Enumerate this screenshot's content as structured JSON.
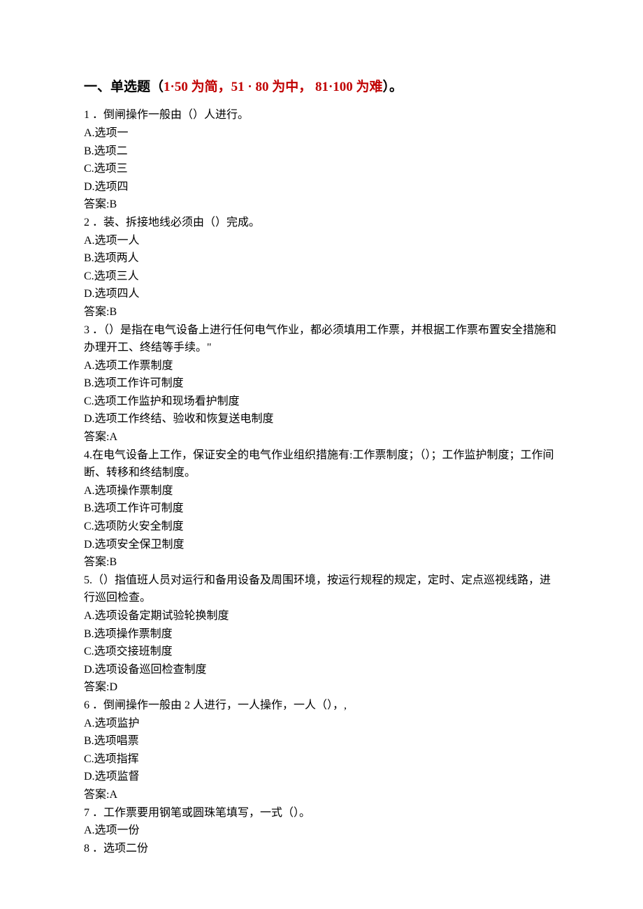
{
  "sectionTitle": {
    "prefix": "一、单选题（",
    "red": "1·50 为简，51 · 80 为中， 81·100 为难",
    "suffix": "）。"
  },
  "questions": [
    {
      "stem": "1 ．倒闸操作一般由（）人进行。",
      "options": [
        "A.选项一",
        "B.选项二",
        "C.选项三",
        "D.选项四"
      ],
      "answer": "答案:B"
    },
    {
      "stem": "2 ．装、拆接地线必须由（）完成。",
      "options": [
        "A.选项一人",
        "B.选项两人",
        "C.选项三人",
        "D.选项四人"
      ],
      "answer": "答案:B"
    },
    {
      "stem": "3 ．（）是指在电气设备上进行任何电气作业，都必须填用工作票，并根据工作票布置安全措施和办理开工、终结等手续。\"",
      "options": [
        "A.选项工作票制度",
        "B.选项工作许可制度",
        "C.选项工作监护和现场看护制度",
        "D.选项工作终结、验收和恢复送电制度"
      ],
      "answer": "答案:A"
    },
    {
      "stem": "4.在电气设备上工作，保证安全的电气作业组织措施有:工作票制度；（）；工作监护制度；工作间断、转移和终结制度。",
      "options": [
        "A.选项操作票制度",
        "B.选项工作许可制度",
        "C.选项防火安全制度",
        "D.选项安全保卫制度"
      ],
      "answer": "答案:B"
    },
    {
      "stem": "5.（）指值班人员对运行和备用设备及周围环境，按运行规程的规定，定时、定点巡视线路，进行巡回检查。",
      "options": [
        "A.选项设备定期试验轮换制度",
        "B.选项操作票制度",
        "C.选项交接班制度",
        "D.选项设备巡回检查制度"
      ],
      "answer": "答案:D"
    },
    {
      "stem": "6 ．倒闸操作一般由 2 人进行，一人操作，一人（），,",
      "options": [
        "A.选项监护",
        "B.选项唱票",
        "C.选项指挥",
        "D.选项监督"
      ],
      "answer": "答案:A"
    },
    {
      "stem": "7 ．工作票要用钢笔或圆珠笔填写，一式（）。",
      "options": [
        "A.选项一份",
        "8 ．选项二份"
      ],
      "answer": null
    }
  ]
}
